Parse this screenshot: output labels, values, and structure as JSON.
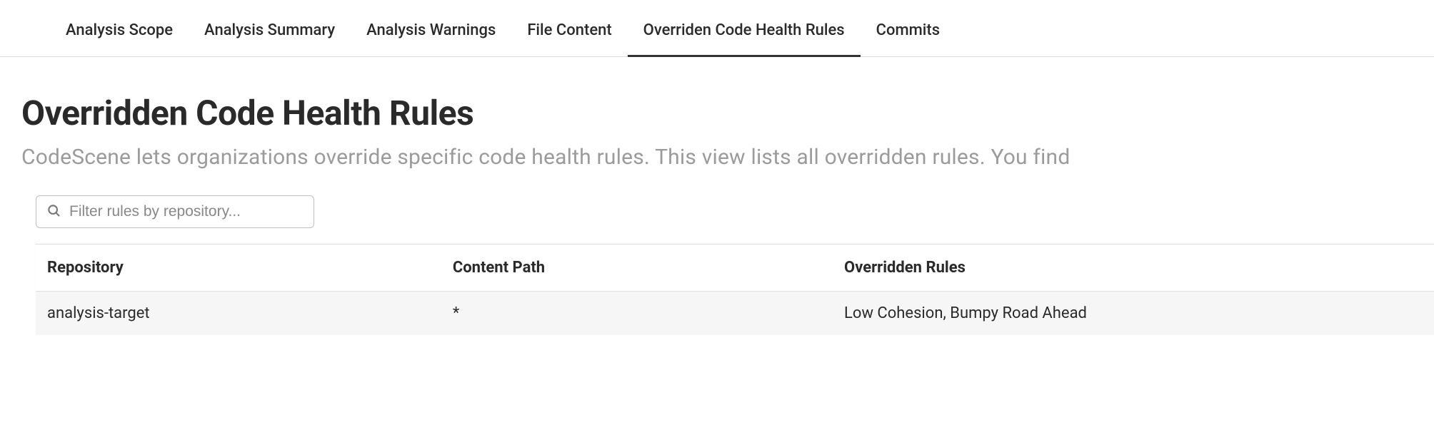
{
  "tabs": [
    {
      "label": "Analysis Scope",
      "active": false
    },
    {
      "label": "Analysis Summary",
      "active": false
    },
    {
      "label": "Analysis Warnings",
      "active": false
    },
    {
      "label": "File Content",
      "active": false
    },
    {
      "label": "Overriden Code Health Rules",
      "active": true
    },
    {
      "label": "Commits",
      "active": false
    }
  ],
  "page": {
    "title": "Overridden Code Health Rules",
    "description": "CodeScene lets organizations override specific code health rules. This view lists all overridden rules. You find"
  },
  "filter": {
    "placeholder": "Filter rules by repository..."
  },
  "table": {
    "headers": {
      "repository": "Repository",
      "content_path": "Content Path",
      "overridden_rules": "Overridden Rules"
    },
    "rows": [
      {
        "repository": "analysis-target",
        "content_path": "*",
        "overridden_rules": "Low Cohesion, Bumpy Road Ahead"
      }
    ]
  }
}
